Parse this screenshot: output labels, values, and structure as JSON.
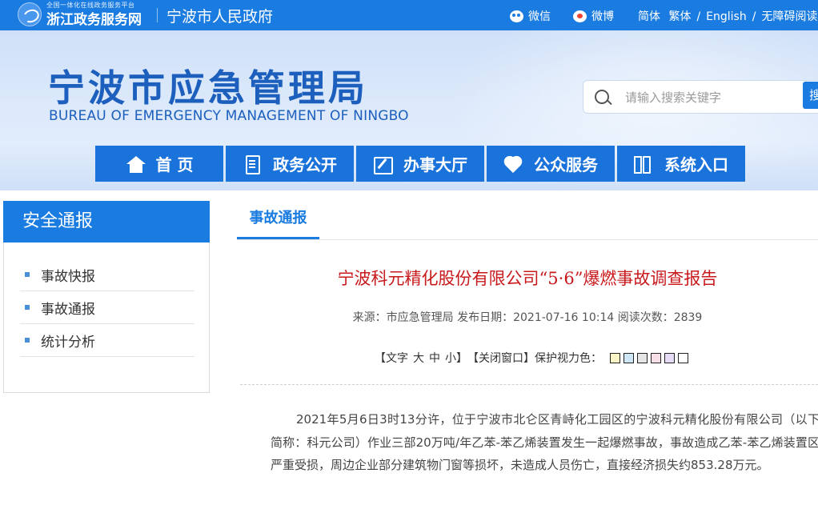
{
  "topbar": {
    "platform_small": "全国一体化在线政务服务平台",
    "platform_name": "浙江政务服务网",
    "city_gov": "宁波市人民政府",
    "wechat": "微信",
    "weibo": "微博",
    "simplified": "简体",
    "traditional": "繁体",
    "english": "English",
    "accessible": "无障碍阅读"
  },
  "header": {
    "title": "宁波市应急管理局",
    "subtitle": "BUREAU OF EMERGENCY MANAGEMENT OF NINGBO",
    "search_placeholder": "请输入搜索关键字",
    "search_button": "搜"
  },
  "nav": [
    {
      "label": "首 页",
      "icon": "home-icon"
    },
    {
      "label": "政务公开",
      "icon": "document-icon"
    },
    {
      "label": "办事大厅",
      "icon": "edit-icon"
    },
    {
      "label": "公众服务",
      "icon": "heart-hands-icon"
    },
    {
      "label": "系统入口",
      "icon": "books-icon"
    }
  ],
  "sidebar": {
    "title": "安全通报",
    "items": [
      "事故快报",
      "事故通报",
      "统计分析"
    ]
  },
  "content": {
    "tab": "事故通报",
    "title": "宁波科元精化股份有限公司“5·6”爆燃事故调查报告",
    "meta": "来源：市应急管理局 发布日期：2021-07-16 10:14 阅读次数：2839",
    "tools": {
      "prefix": "【文字",
      "large": "大",
      "medium": "中",
      "small": "小",
      "suffix": "】",
      "close": "【关闭窗口】",
      "eye_color": "保护视力色："
    },
    "swatches": [
      "#fbf5c6",
      "#cfe6f7",
      "#e5e5e5",
      "#f7dfe8",
      "#e6dcf5",
      "#ffffff"
    ],
    "paragraph": "2021年5月6日3时13分许，位于宁波市北仑区青峙化工园区的宁波科元精化股份有限公司（以下简称：科元公司）作业三部20万吨/年乙苯-苯乙烯装置发生一起爆燃事故，事故造成乙苯-苯乙烯装置区严重受损，周边企业部分建筑物门窗等损坏，未造成人员伤亡，直接经济损失约853.28万元。"
  }
}
